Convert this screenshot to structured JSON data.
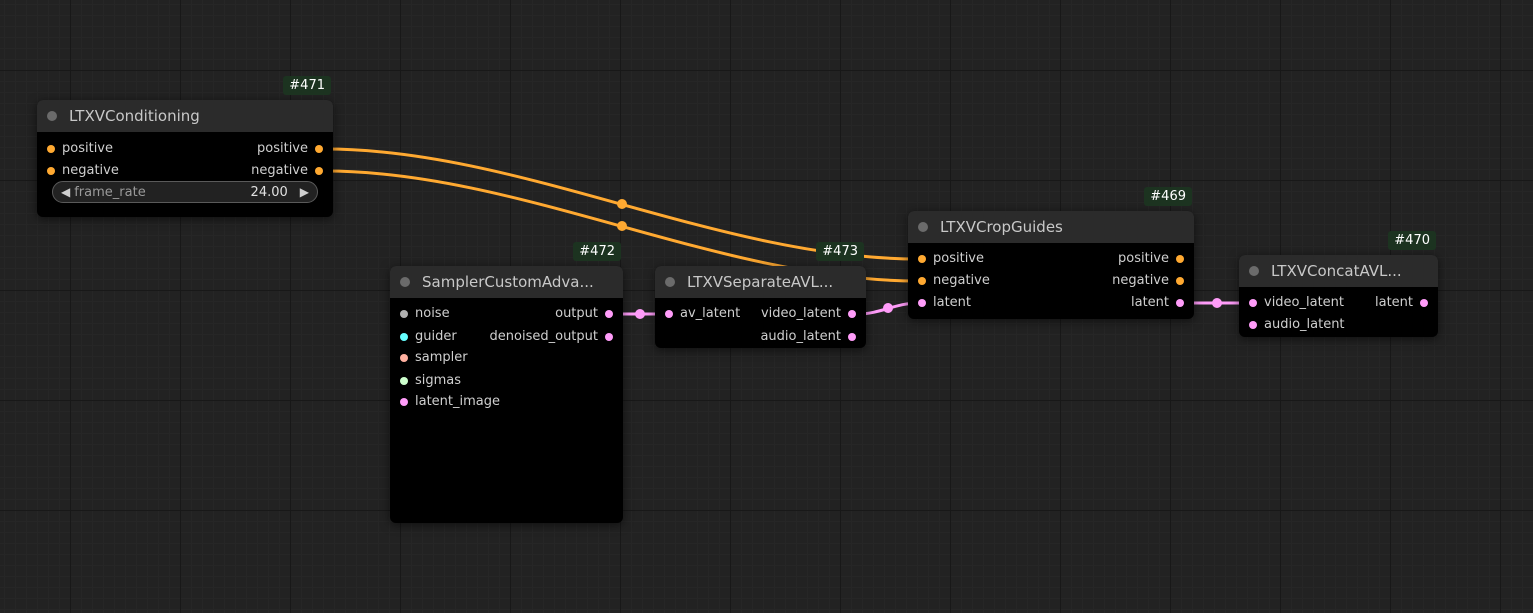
{
  "colors": {
    "conditioning": "#ffa931",
    "latent": "#ff9cf9",
    "noise": "#b0b0b0",
    "guider": "#66ffff",
    "sampler": "#ffb0a0",
    "sigmas": "#cdffcd"
  },
  "nodes": {
    "ltxv_conditioning": {
      "id": "#471",
      "title": "LTXVConditioning",
      "inputs": [
        "positive",
        "negative"
      ],
      "outputs": [
        "positive",
        "negative"
      ],
      "widget": {
        "name": "frame_rate",
        "value": "24.00"
      }
    },
    "sampler_custom_advanced": {
      "id": "#472",
      "title": "SamplerCustomAdva...",
      "inputs": [
        "noise",
        "guider",
        "sampler",
        "sigmas",
        "latent_image"
      ],
      "outputs": [
        "output",
        "denoised_output"
      ]
    },
    "ltxv_separate_av_latent": {
      "id": "#473",
      "title": "LTXVSeparateAVL...",
      "inputs": [
        "av_latent"
      ],
      "outputs": [
        "video_latent",
        "audio_latent"
      ]
    },
    "ltxv_crop_guides": {
      "id": "#469",
      "title": "LTXVCropGuides",
      "inputs": [
        "positive",
        "negative",
        "latent"
      ],
      "outputs": [
        "positive",
        "negative",
        "latent"
      ]
    },
    "ltxv_concat_av_latent": {
      "id": "#470",
      "title": "LTXVConcatAVL...",
      "inputs": [
        "video_latent",
        "audio_latent"
      ],
      "outputs": [
        "latent"
      ]
    }
  }
}
